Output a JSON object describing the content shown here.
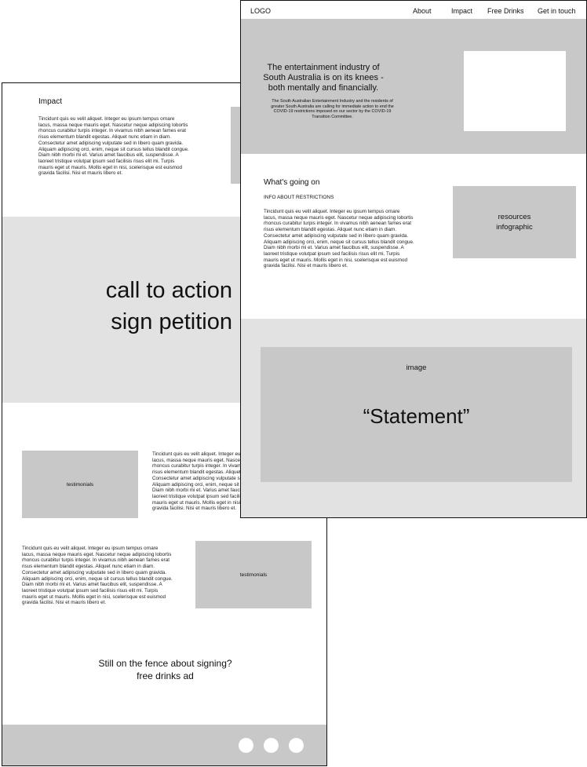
{
  "lorem": "Tincidunt quis eu velit aliquet. Integer eu ipsum tempus ornare\nlacus, massa neque mauris eget. Nascetur neque adipiscing lobortis\nrhoncus curabitur turpis integer. In vivamus nibh aenean fames erat\nrisus elementum blandit egestas. Aliquet nunc etiam in diam.\nConsectetur amet adipiscing vulputate sed in libero quam gravida.\nAliquam adipiscing orci, enim, neque sit cursus tellus blandit congue.\nDiam nibh morbi mi et. Varius amet faucibus elit, suspendisse. A\nlaoreet tristique volutpat ipsum sed facilisis risus elit mi. Turpis\nmauris eget ut mauris. Mollis eget in nisi, scelerisque est euismod\ngravida facilisi. Nisi et mauris libero et.",
  "back": {
    "impact_heading": "Impact",
    "cta_line1": "call to action",
    "cta_line2": "sign petition",
    "testimonials_1": "testimonials",
    "testimonials_2": "testimonials",
    "fence_line1": "Still on the fence about signing?",
    "fence_line2": "free drinks ad"
  },
  "front": {
    "nav": {
      "logo": "LOGO",
      "about": "About",
      "impact": "Impact",
      "free_drinks": "Free Drinks",
      "get_in_touch": "Get in touch"
    },
    "hero": {
      "title": "The entertainment industry of\nSouth Australia is on its knees -\nboth mentally and financially.",
      "body": "The South Australian Entertainment Industry and the residents of\ngreater South Australia are calling for immediate action to end the\nCOVID-19 restrictions imposed on our sector by the COVID-19\nTransition Committee."
    },
    "whats_going_on": "What's going on",
    "info_restrictions": "INFO ABOUT RESTRICTIONS",
    "resources": "resources\ninfographic",
    "image_label": "image",
    "statement": "“Statement”"
  }
}
